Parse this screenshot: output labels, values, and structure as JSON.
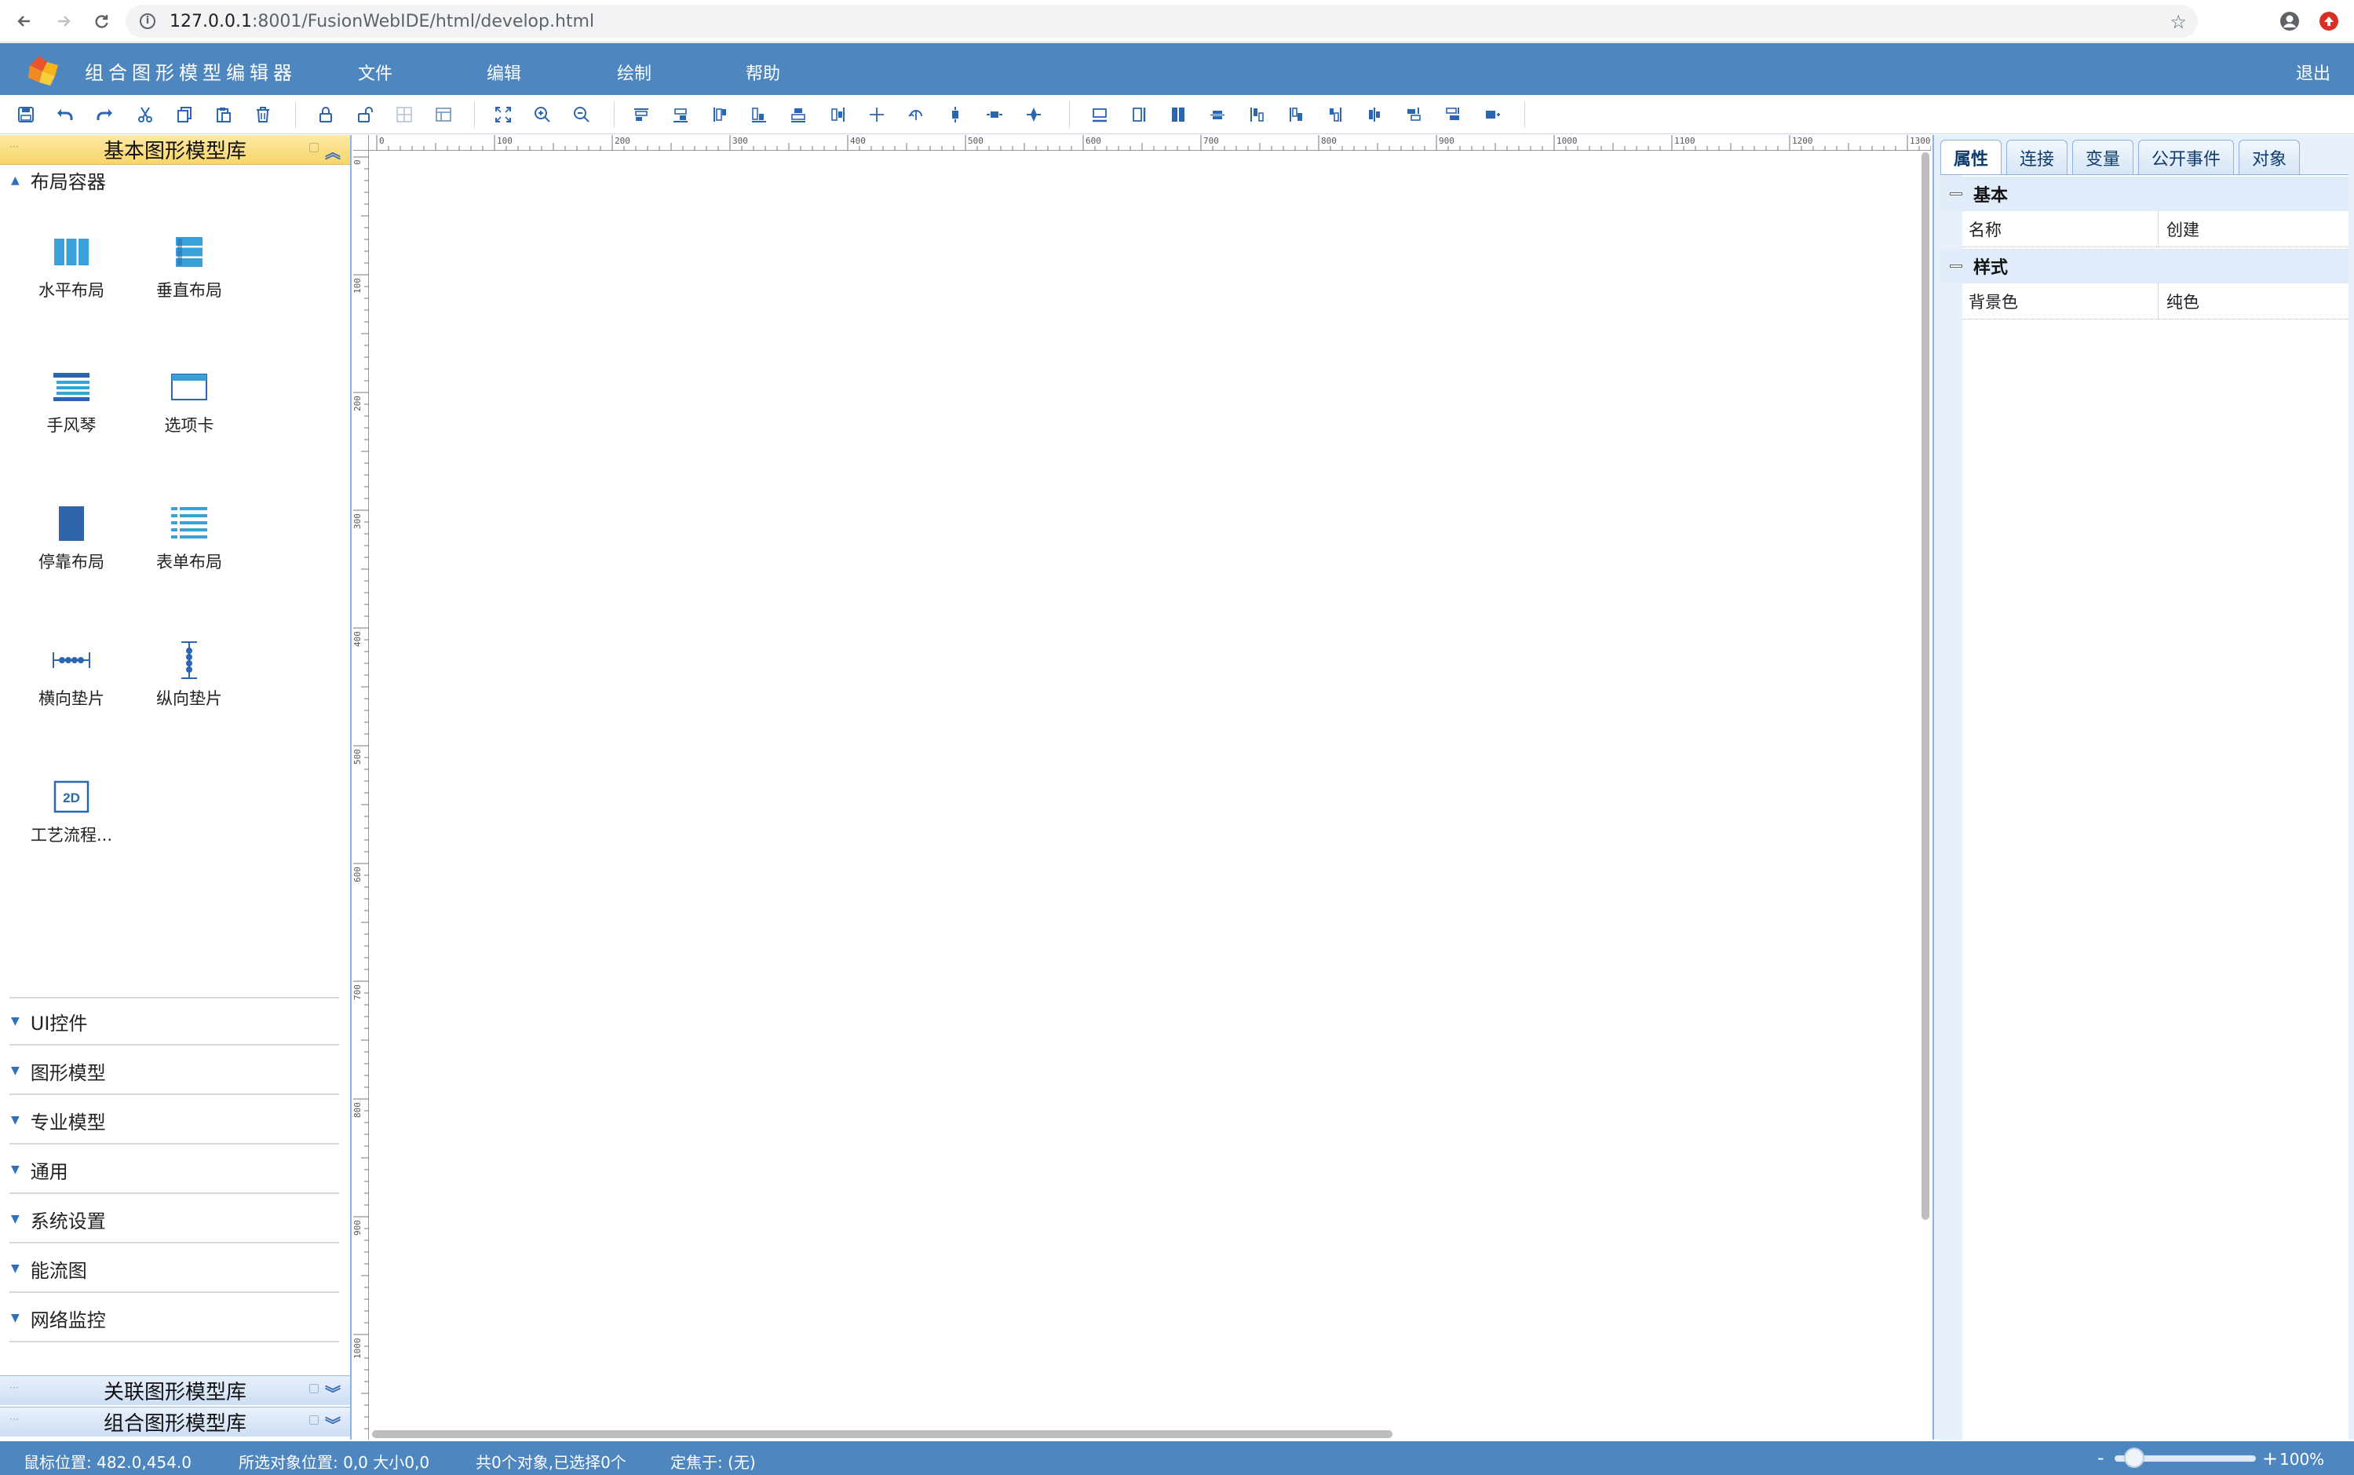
{
  "browser": {
    "url_host": "127.0.0.1",
    "url_rest": ":8001/FusionWebIDE/html/develop.html"
  },
  "header": {
    "title": "组合图形模型编辑器",
    "menu": [
      "文件",
      "编辑",
      "绘制",
      "帮助"
    ],
    "logout": "退出"
  },
  "toolbar": {
    "groups": [
      [
        "save-icon",
        "undo-icon",
        "redo-icon",
        "cut-icon",
        "copy-icon",
        "paste-icon",
        "delete-icon"
      ],
      [
        "lock-icon",
        "unlock-icon",
        "group-icon",
        "ungroup-icon"
      ],
      [
        "fit-icon",
        "zoom-in-icon",
        "zoom-out-icon"
      ],
      [
        "align-top-icon",
        "align-middle-icon",
        "align-left-icon",
        "align-center-icon",
        "align-bottom-icon",
        "align-right-icon",
        "center-cross-icon",
        "rotate-icon",
        "vertical-distribute-icon",
        "horizontal-distribute-icon",
        "center-icon"
      ],
      [
        "same-width-icon",
        "same-height-icon",
        "same-size-icon",
        "space-h-icon",
        "space-v-icon",
        "order-front-icon",
        "order-back-icon",
        "order-up-icon",
        "order-down-icon",
        "order-top-icon",
        "order-bottom-icon"
      ]
    ]
  },
  "left_panel": {
    "active_header": "基本图形模型库",
    "open_category": "布局容器",
    "tiles": [
      {
        "label": "水平布局",
        "icon": "horizontal-layout-icon"
      },
      {
        "label": "垂直布局",
        "icon": "vertical-layout-icon"
      },
      {
        "label": "手风琴",
        "icon": "accordion-icon"
      },
      {
        "label": "选项卡",
        "icon": "tabs-icon"
      },
      {
        "label": "停靠布局",
        "icon": "dock-layout-icon"
      },
      {
        "label": "表单布局",
        "icon": "form-layout-icon"
      },
      {
        "label": "横向垫片",
        "icon": "horizontal-spacer-icon"
      },
      {
        "label": "纵向垫片",
        "icon": "vertical-spacer-icon"
      },
      {
        "label": "工艺流程...",
        "icon": "process-2d-icon",
        "icon_text": "2D"
      }
    ],
    "categories": [
      "UI控件",
      "图形模型",
      "专业模型",
      "通用",
      "系统设置",
      "能流图",
      "网络监控"
    ],
    "bottom_headers": [
      "关联图形模型库",
      "组合图形模型库"
    ]
  },
  "canvas": {
    "ruler_top": [
      "0",
      "100",
      "200",
      "300",
      "400",
      "500",
      "600",
      "700",
      "800",
      "900",
      "1000",
      "1100",
      "1200",
      "1300"
    ],
    "ruler_left": [
      "0",
      "100",
      "200",
      "300",
      "400",
      "500",
      "600",
      "700",
      "800",
      "900",
      "1000"
    ]
  },
  "right_panel": {
    "tabs": [
      "属性",
      "连接",
      "变量",
      "公开事件",
      "对象"
    ],
    "active_tab": "属性",
    "groups": [
      {
        "name": "基本",
        "rows": [
          {
            "name": "名称",
            "value": "创建"
          }
        ]
      },
      {
        "name": "样式",
        "rows": [
          {
            "name": "背景色",
            "value": "纯色"
          }
        ]
      }
    ]
  },
  "status": {
    "mouse_pos": "鼠标位置: 482.0,454.0",
    "selected_pos": "所选对象位置: 0,0 大小0,0",
    "objects": "共0个对象,已选择0个",
    "focus": "定焦于: (无)",
    "zoom_minus": "-",
    "zoom_plus": "+",
    "zoom_value": "100%",
    "zoom_level": 0.14
  },
  "colors": {
    "header_bg": "#4e86c0",
    "icon_blue": "#2b66b0",
    "tile_blue": "#3aa0d8",
    "active_header": "#f9d66a"
  }
}
